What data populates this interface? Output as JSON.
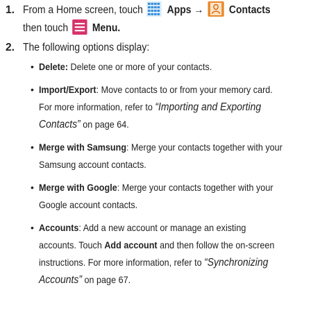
{
  "step1": {
    "number": "1.",
    "line1_a": "From a Home screen, touch",
    "apps_label": "Apps →",
    "contacts_label": "Contacts",
    "line2_a": "then touch",
    "menu_label": "Menu.",
    "icons": [
      "apps-grid-icon",
      "contacts-person-icon",
      "menu-icon"
    ],
    "colors": {
      "apps": "#3a8fd9",
      "contacts": "#e8892c",
      "menu": "#d6336c"
    }
  },
  "step2": {
    "number": "2.",
    "text": "The following options display:",
    "bullets": [
      {
        "term": "Delete:",
        "lines": [
          "Delete one or more of your contacts."
        ]
      },
      {
        "term": "Import/Export",
        "line1": ": Move contacts to or from your memory card.",
        "line2": "For more information, refer to",
        "ref_a": "“Importing and Exporting",
        "ref_b": "Contacts”",
        "page": "on page 64."
      },
      {
        "term": "Merge with Samsung",
        "line1": ": Merge your contacts together with your",
        "line2": "Samsung account contacts."
      },
      {
        "term": "Merge with Google",
        "line1": ": Merge your contacts together with your",
        "line2": "Google account contacts."
      },
      {
        "term": "Accounts",
        "line1": ": Add a new account or manage an existing",
        "line2": "accounts. Touch",
        "add_account": "Add account",
        "line2_b": "and then follow the on-screen",
        "line3": "instructions. For more information, refer to",
        "ref_a": "“Synchronizing",
        "ref_b": "Accounts”",
        "page": "on page 67."
      }
    ]
  }
}
